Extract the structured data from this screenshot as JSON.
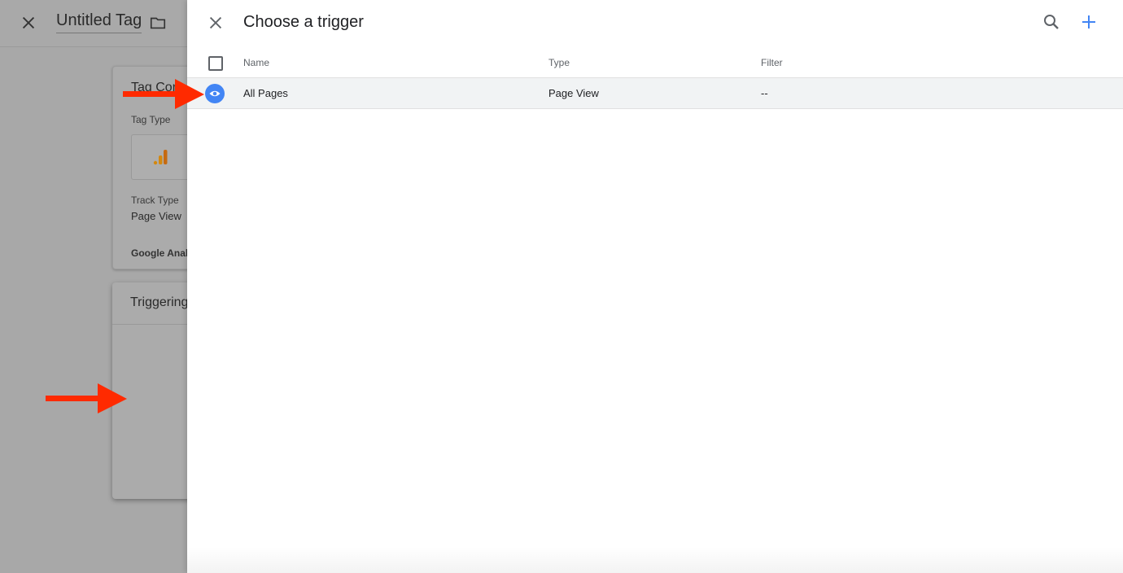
{
  "background": {
    "title": "Untitled Tag",
    "tag_config_title": "Tag Con",
    "tag_type_label": "Tag Type",
    "track_type_label": "Track Type",
    "track_type_value": "Page View",
    "google_analytics_label": "Google Anal",
    "triggering_title": "Triggering"
  },
  "panel": {
    "title": "Choose a trigger",
    "columns": [
      "Name",
      "Type",
      "Filter"
    ],
    "rows": [
      {
        "name": "All Pages",
        "type": "Page View",
        "filter": "--"
      }
    ]
  },
  "colors": {
    "accent_blue": "#4285f4",
    "annotation_arrow": "#ff2a00",
    "analytics_orange": "#e8710a"
  }
}
